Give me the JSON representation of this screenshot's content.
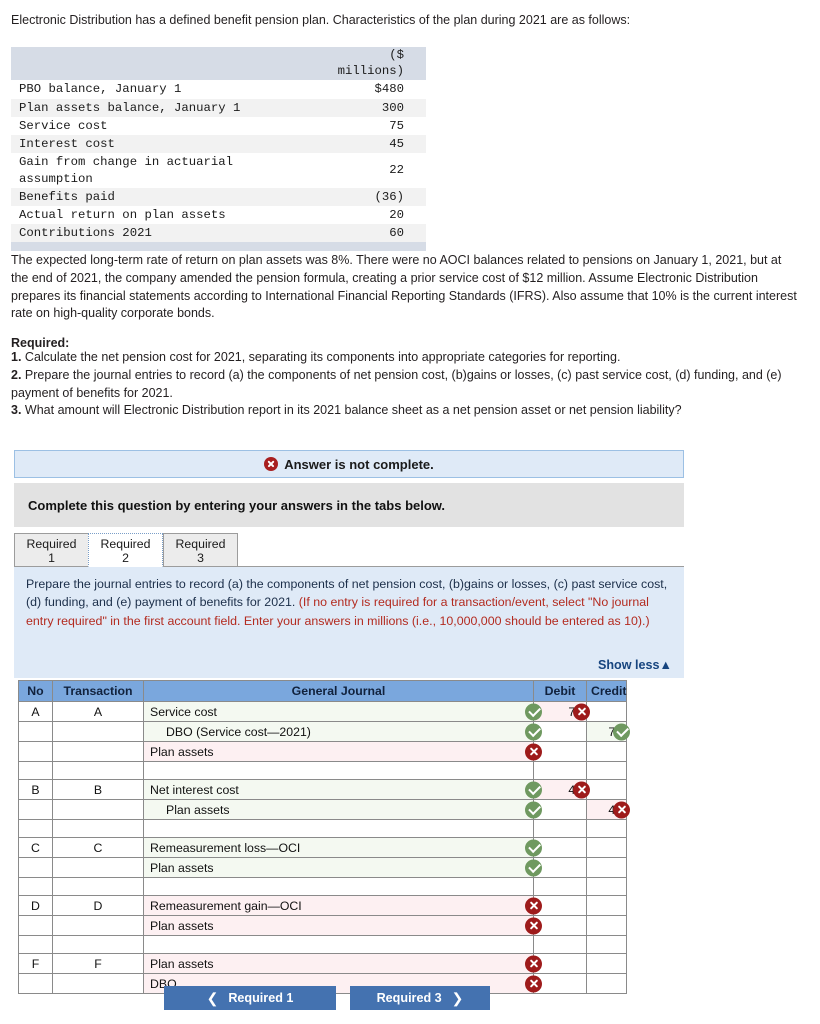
{
  "intro": "Electronic Distribution has a defined benefit pension plan. Characteristics of the plan during 2021 are as follows:",
  "facts_table": {
    "header_value": "($ millions)",
    "header_line1": "($",
    "header_line2": "millions)",
    "rows": [
      {
        "label": "PBO balance, January 1",
        "value": "$480"
      },
      {
        "label": "Plan assets balance, January 1",
        "value": "300"
      },
      {
        "label": "Service cost",
        "value": "75"
      },
      {
        "label": "Interest cost",
        "value": "45"
      },
      {
        "label": "Gain from change in actuarial assumption",
        "value": "22"
      },
      {
        "label": "Benefits paid",
        "value": "(36)"
      },
      {
        "label": "Actual return on plan assets",
        "value": "20"
      },
      {
        "label": "Contributions 2021",
        "value": "60"
      }
    ]
  },
  "expected_paragraph": "The expected long-term rate of return on plan assets was 8%. There were no AOCI balances related to pensions on January 1, 2021, but at the end of 2021, the company amended the pension formula, creating a prior service cost of $12 million. Assume Electronic Distribution prepares its financial statements according to International Financial Reporting Standards (IFRS). Also assume that 10% is the current interest rate on high-quality corporate bonds.",
  "required_heading": "Required:",
  "required_items": [
    {
      "num": "1.",
      "text": "Calculate the net pension cost for 2021, separating its components into appropriate categories for reporting."
    },
    {
      "num": "2.",
      "text": "Prepare the journal entries to record (a) the components of net pension cost, (b)gains or losses, (c) past service cost, (d) funding, and (e) payment of benefits for 2021."
    },
    {
      "num": "3.",
      "text": "What amount will Electronic Distribution report in its 2021 balance sheet as a net pension asset or net pension liability?"
    }
  ],
  "status_banner": {
    "icon": "error-x-icon",
    "text": "Answer is not complete."
  },
  "complete_instruction": "Complete this question by entering your answers in the tabs below.",
  "tabs": [
    {
      "line1": "Required",
      "line2": "1",
      "active": false
    },
    {
      "line1": "Required",
      "line2": "2",
      "active": true
    },
    {
      "line1": "Required",
      "line2": "3",
      "active": false
    }
  ],
  "panel": {
    "prompt_black": "Prepare the journal entries to record (a) the components of net pension cost, (b)gains or losses, (c) past service cost, (d) funding, and (e) payment of benefits for 2021. ",
    "prompt_red": "(If no entry is required for a transaction/event, select \"No journal entry required\" in the first account field. Enter your answers in millions (i.e., 10,000,000 should be entered as 10).)",
    "show_less": "Show less",
    "show_less_icon": "triangle-up-icon"
  },
  "journal": {
    "columns": [
      "No",
      "Transaction",
      "General Journal",
      "Debit",
      "Credit"
    ],
    "rows": [
      {
        "type": "entry",
        "no": "A",
        "transaction": "A",
        "account": "Service cost",
        "indent": false,
        "account_mark": "ok",
        "debit": "75",
        "debit_mark": "bad",
        "credit": "",
        "credit_mark": ""
      },
      {
        "type": "entry",
        "no": "",
        "transaction": "",
        "account": "DBO (Service cost—2021)",
        "indent": true,
        "account_mark": "ok",
        "debit": "",
        "debit_mark": "",
        "credit": "75",
        "credit_mark": "ok"
      },
      {
        "type": "entry",
        "no": "",
        "transaction": "",
        "account": "Plan assets",
        "indent": false,
        "account_mark": "bad",
        "debit": "",
        "debit_mark": "",
        "credit": "",
        "credit_mark": ""
      },
      {
        "type": "blank"
      },
      {
        "type": "entry",
        "no": "B",
        "transaction": "B",
        "account": "Net interest cost",
        "indent": false,
        "account_mark": "ok",
        "debit": "45",
        "debit_mark": "bad",
        "credit": "",
        "credit_mark": ""
      },
      {
        "type": "entry",
        "no": "",
        "transaction": "",
        "account": "Plan assets",
        "indent": true,
        "account_mark": "ok",
        "debit": "",
        "debit_mark": "",
        "credit": "45",
        "credit_mark": "bad"
      },
      {
        "type": "blank"
      },
      {
        "type": "entry",
        "no": "C",
        "transaction": "C",
        "account": "Remeasurement loss—OCI",
        "indent": false,
        "account_mark": "ok",
        "debit": "",
        "debit_mark": "",
        "credit": "",
        "credit_mark": ""
      },
      {
        "type": "entry",
        "no": "",
        "transaction": "",
        "account": "Plan assets",
        "indent": false,
        "account_mark": "ok",
        "debit": "",
        "debit_mark": "",
        "credit": "",
        "credit_mark": ""
      },
      {
        "type": "blank"
      },
      {
        "type": "entry",
        "no": "D",
        "transaction": "D",
        "account": "Remeasurement gain—OCI",
        "indent": false,
        "account_mark": "bad",
        "debit": "",
        "debit_mark": "",
        "credit": "",
        "credit_mark": ""
      },
      {
        "type": "entry",
        "no": "",
        "transaction": "",
        "account": "Plan assets",
        "indent": false,
        "account_mark": "bad",
        "debit": "",
        "debit_mark": "",
        "credit": "",
        "credit_mark": ""
      },
      {
        "type": "blank"
      },
      {
        "type": "entry",
        "no": "F",
        "transaction": "F",
        "account": "Plan assets",
        "indent": false,
        "account_mark": "bad",
        "debit": "",
        "debit_mark": "",
        "credit": "",
        "credit_mark": ""
      },
      {
        "type": "entry",
        "no": "",
        "transaction": "",
        "account": "DBO",
        "indent": false,
        "account_mark": "bad",
        "debit": "",
        "debit_mark": "",
        "credit": "",
        "credit_mark": ""
      }
    ]
  },
  "nav": {
    "prev_label": "Required 1",
    "prev_icon": "chevron-left-icon",
    "next_label": "Required 3",
    "next_icon": "chevron-right-icon"
  },
  "colors": {
    "header_blue": "#7aa7dd",
    "panel_blue": "#dfeaf7",
    "button_blue": "#4472b0",
    "error_red": "#9e1b1b",
    "ok_green": "#6f9960",
    "red_text": "#b32b20"
  }
}
